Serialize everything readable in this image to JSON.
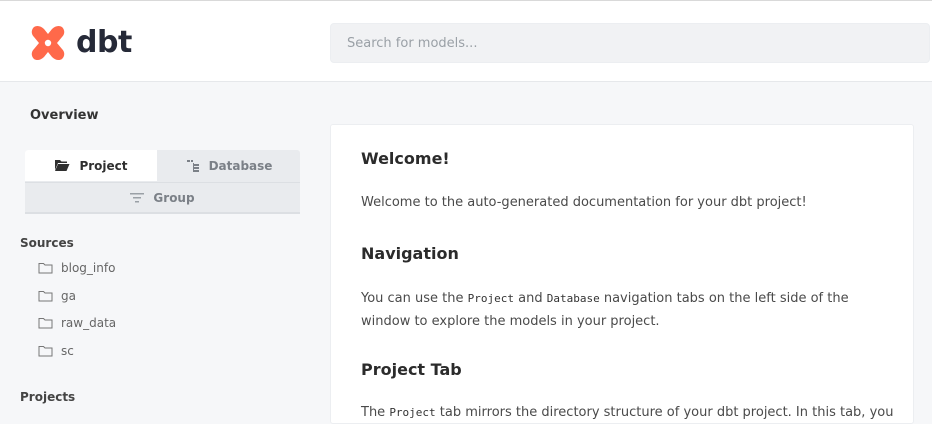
{
  "brand": {
    "name": "dbt",
    "color": "#ff694a"
  },
  "search": {
    "placeholder": "Search for models..."
  },
  "sidebar": {
    "overview": "Overview",
    "tabs": {
      "project": "Project",
      "database": "Database",
      "group": "Group"
    },
    "sources_title": "Sources",
    "sources": [
      "blog_info",
      "ga",
      "raw_data",
      "sc"
    ],
    "projects_title": "Projects"
  },
  "content": {
    "welcome_title": "Welcome!",
    "welcome_text": "Welcome to the auto-generated documentation for your dbt project!",
    "nav_title": "Navigation",
    "nav_text_1": "You can use the ",
    "nav_code_project": "Project",
    "nav_text_2": " and ",
    "nav_code_database": "Database",
    "nav_text_3": " navigation tabs on the left side of the window to explore the models in your project.",
    "project_tab_title": "Project Tab",
    "project_text_1": "The ",
    "project_code": "Project",
    "project_text_2": " tab mirrors the directory structure of your dbt project. In this tab, you"
  },
  "icons": {
    "logo": "dbt-logo-icon",
    "project_tab": "folder-open-icon",
    "database_tab": "tree-icon",
    "group_tab": "filter-icon",
    "source_item": "folder-icon"
  }
}
